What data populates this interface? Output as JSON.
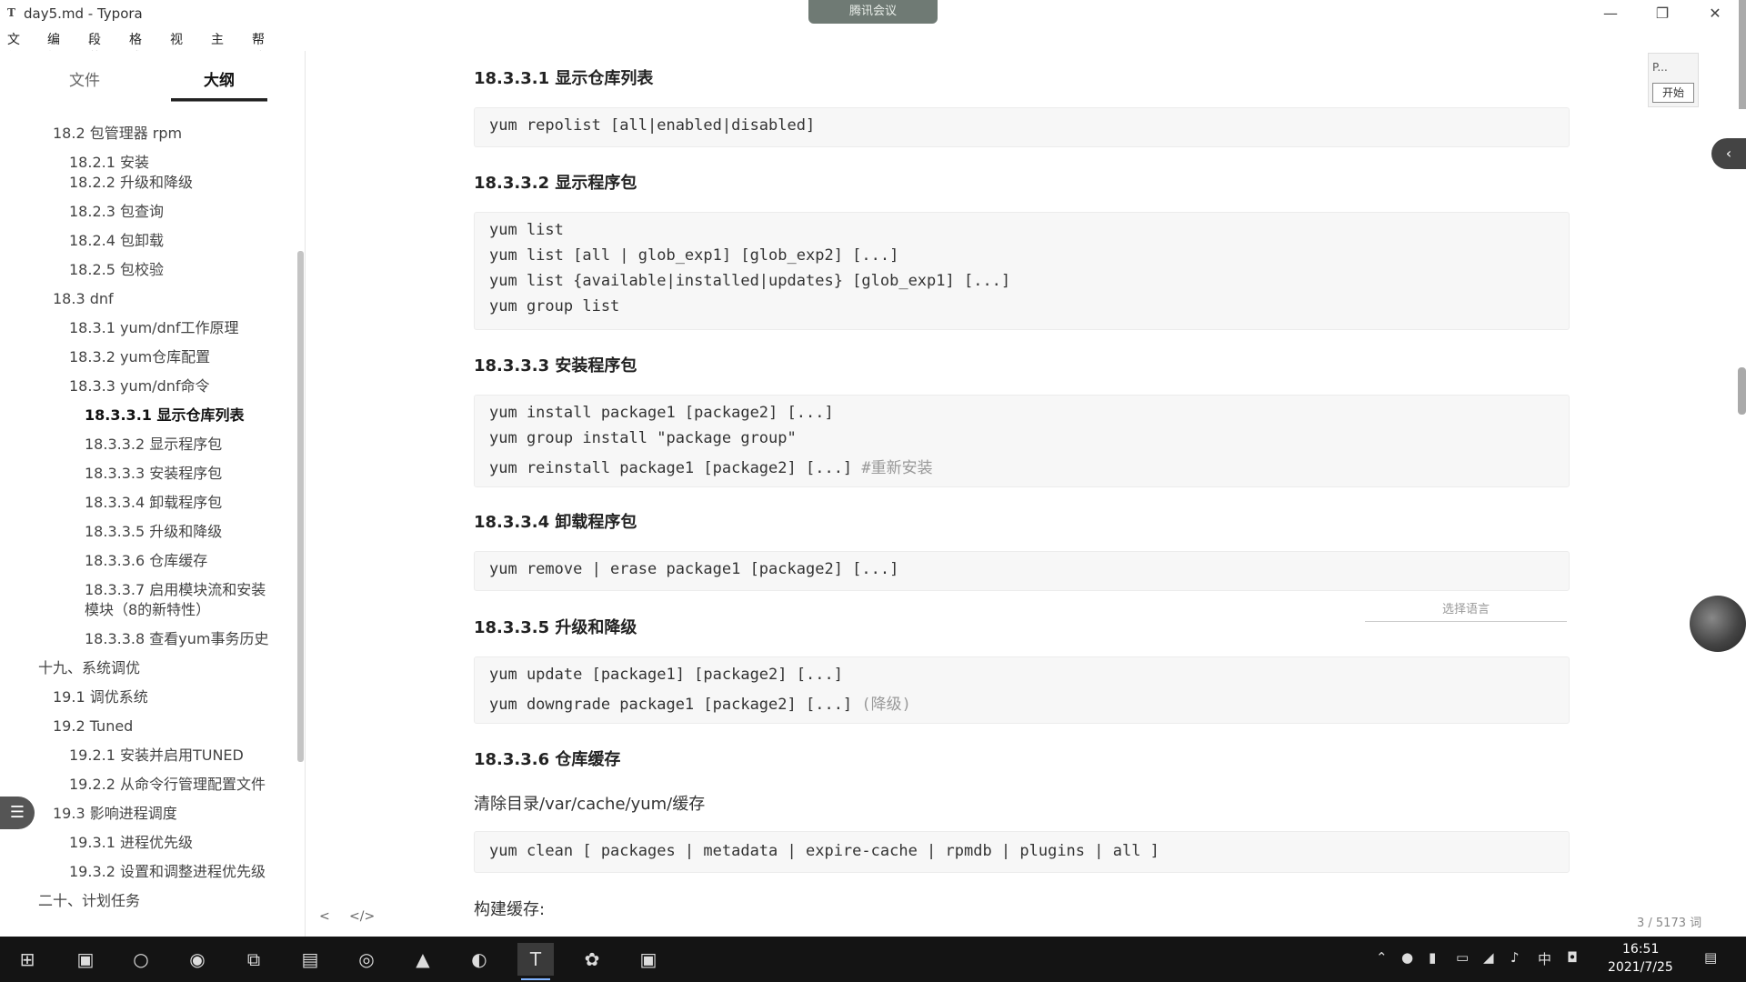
{
  "window": {
    "title": "day5.md - Typora",
    "meeting_label": "腾讯会议",
    "controls": [
      "—",
      "❐",
      "✕"
    ]
  },
  "menu": [
    "文件",
    "编辑",
    "段落",
    "格式",
    "视图",
    "主题",
    "帮助"
  ],
  "sidebar": {
    "tabs": [
      "文件",
      "大纲"
    ],
    "active_tab": "大纲",
    "outline": [
      {
        "text": "18.2 包管理器 rpm",
        "level": 2
      },
      {
        "text": "18.2.1 安装",
        "level": 3
      },
      {
        "text": "18.2.2 升级和降级",
        "level": 3
      },
      {
        "text": "18.2.3 包查询",
        "level": 3
      },
      {
        "text": "18.2.4 包卸载",
        "level": 3
      },
      {
        "text": "18.2.5 包校验",
        "level": 3
      },
      {
        "text": "18.3 dnf",
        "level": 2
      },
      {
        "text": "18.3.1 yum/dnf工作原理",
        "level": 3
      },
      {
        "text": "18.3.2 yum仓库配置",
        "level": 3
      },
      {
        "text": "18.3.3 yum/dnf命令",
        "level": 3
      },
      {
        "text": "18.3.3.1 显示仓库列表",
        "level": 4,
        "active": true
      },
      {
        "text": "18.3.3.2 显示程序包",
        "level": 4
      },
      {
        "text": "18.3.3.3 安装程序包",
        "level": 4
      },
      {
        "text": "18.3.3.4 卸载程序包",
        "level": 4
      },
      {
        "text": "18.3.3.5 升级和降级",
        "level": 4
      },
      {
        "text": "18.3.3.6 仓库缓存",
        "level": 4
      },
      {
        "text": "18.3.3.7 启用模块流和安装",
        "level": 4
      },
      {
        "text": "模块（8的新特性）",
        "level": 4
      },
      {
        "text": "18.3.3.8 查看yum事务历史",
        "level": 4
      },
      {
        "text": "十九、系统调优",
        "level": 1
      },
      {
        "text": "19.1 调优系统",
        "level": 2
      },
      {
        "text": "19.2 Tuned",
        "level": 2
      },
      {
        "text": "19.2.1 安装并启用TUNED",
        "level": 3
      },
      {
        "text": "19.2.2 从命令行管理配置文件",
        "level": 3
      },
      {
        "text": "19.3 影响进程调度",
        "level": 2
      },
      {
        "text": "19.3.1 进程优先级",
        "level": 3
      },
      {
        "text": "19.3.2 设置和调整进程优先级",
        "level": 3
      },
      {
        "text": "二十、计划任务",
        "level": 1
      }
    ],
    "bottom_buttons": [
      "<",
      "</>"
    ]
  },
  "editor": {
    "sections": [
      {
        "heading": "18.3.3.1 显示仓库列表",
        "code": [
          "yum repolist [all|enabled|disabled]"
        ]
      },
      {
        "heading": "18.3.3.2 显示程序包",
        "code": [
          "yum list",
          "yum list [all | glob_exp1] [glob_exp2] [...]",
          "yum list {available|installed|updates} [glob_exp1] [...]",
          "yum group list"
        ]
      },
      {
        "heading": "18.3.3.3 安装程序包",
        "code": [
          "yum install package1 [package2] [...]",
          "yum group install \"package group\"",
          "yum reinstall package1 [package2] [...] "
        ],
        "comment": "#重新安装"
      },
      {
        "heading": "18.3.3.4 卸载程序包",
        "code": [
          "yum remove | erase package1 [package2] [...]"
        ],
        "lang_placeholder": "选择语言"
      },
      {
        "heading": "18.3.3.5 升级和降级",
        "code": [
          "yum update [package1] [package2] [...]",
          "yum downgrade package1 [package2] [...] "
        ],
        "comment": "(降级)"
      },
      {
        "heading": "18.3.3.6 仓库缓存",
        "para": "清除目录/var/cache/yum/缓存",
        "code": [
          "yum clean [ packages | metadata | expire-cache | rpmdb | plugins | all ]"
        ],
        "para2": "构建缓存:"
      }
    ],
    "word_count": "3 / 5173 词"
  },
  "overlay": {
    "mini_text": "P...",
    "mini_button": "开始"
  },
  "taskbar": {
    "time": "16:51",
    "date": "2021/7/25",
    "ime": "中"
  }
}
